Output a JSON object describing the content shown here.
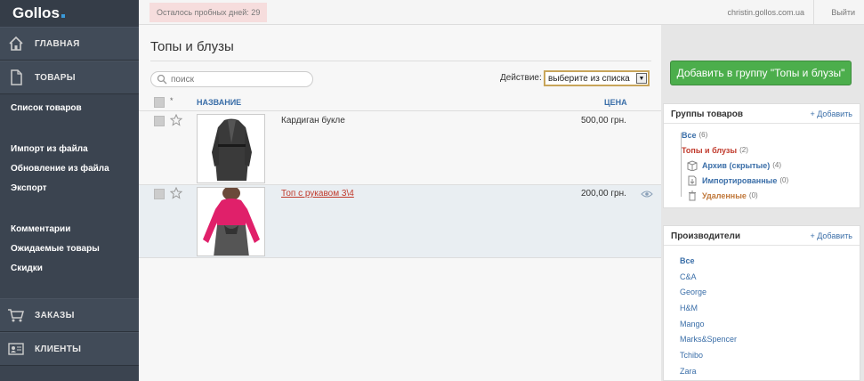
{
  "app": {
    "logo": "Gollos"
  },
  "sidebar": {
    "home": {
      "label": "ГЛАВНАЯ",
      "icon": "home-icon"
    },
    "products": {
      "label": "ТОВАРЫ",
      "icon": "document-icon"
    },
    "submenu_group1": [
      "Список товаров"
    ],
    "submenu_group2": [
      "Импорт из файла",
      "Обновление из файла",
      "Экспорт"
    ],
    "submenu_group3": [
      "Комментарии",
      "Ожидаемые товары",
      "Скидки"
    ],
    "orders": {
      "label": "ЗАКАЗЫ",
      "icon": "cart-icon"
    },
    "clients": {
      "label": "КЛИЕНТЫ",
      "icon": "contact-card-icon"
    }
  },
  "topbar": {
    "trial": "Осталось пробных дней: 29",
    "email": "christin.gollos.com.ua",
    "logout": "Выйти"
  },
  "main": {
    "title": "Топы и блузы",
    "search_placeholder": "поиск",
    "action_label": "Действие:",
    "action_selected": "выберите из списка",
    "columns": {
      "star": "*",
      "name": "НАЗВАНИЕ",
      "price": "ЦЕНА"
    },
    "products": [
      {
        "name": "Кардиган букле",
        "price": "500,00 грн."
      },
      {
        "name": "Топ с рукавом 3\\4",
        "price": "200,00 грн."
      }
    ]
  },
  "right": {
    "add_to_group": "Добавить в группу \"Топы и блузы\"",
    "groups": {
      "title": "Группы товаров",
      "add": "+ Добавить",
      "items": [
        {
          "label": "Все",
          "count": "(6)"
        },
        {
          "label": "Топы и блузы",
          "count": "(2)"
        },
        {
          "label": "Архив (скрытые)",
          "count": "(4)"
        },
        {
          "label": "Импортированные",
          "count": "(0)"
        },
        {
          "label": "Удаленные",
          "count": "(0)"
        }
      ]
    },
    "brands": {
      "title": "Производители",
      "add": "+ Добавить",
      "items": [
        "Все",
        "C&A",
        "George",
        "H&M",
        "Mango",
        "Marks&Spencer",
        "Tchibo",
        "Zara"
      ]
    }
  },
  "colors": {
    "sidebar_bg": "#3b4450",
    "accent_green": "#4cae4c",
    "link_blue": "#3a6ea8",
    "active_red": "#c0392b"
  }
}
